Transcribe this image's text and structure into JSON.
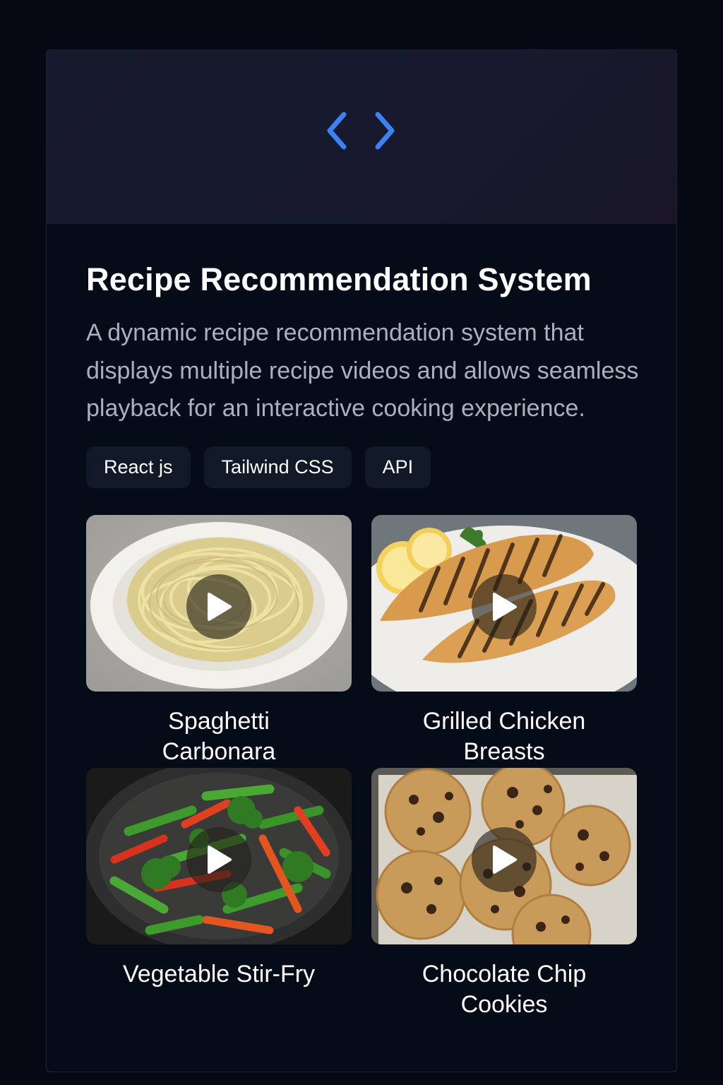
{
  "project": {
    "banner_icon": "code-brackets-icon",
    "title": "Recipe Recommendation System",
    "description": "A dynamic recipe recommendation system that displays multiple recipe videos and allows seamless playback for an interactive cooking experience.",
    "tags": [
      "React js",
      "Tailwind CSS",
      "API"
    ]
  },
  "recipes": [
    {
      "name": "Spaghetti Carbonara",
      "image": "spaghetti-plate",
      "icon": "play-icon"
    },
    {
      "name": "Grilled Chicken Breasts",
      "image": "grilled-chicken-plate",
      "icon": "play-icon"
    },
    {
      "name": "Vegetable Stir-Fry",
      "image": "stir-fry-bowl",
      "icon": "play-icon"
    },
    {
      "name": "Chocolate Chip Cookies",
      "image": "cookies-tray",
      "icon": "play-icon"
    }
  ],
  "colors": {
    "page_bg": "#050914",
    "card_bg": "#060b18",
    "accent_blue": "#3b82f6",
    "tag_bg": "#111827",
    "text_muted": "#a9b0bf"
  }
}
